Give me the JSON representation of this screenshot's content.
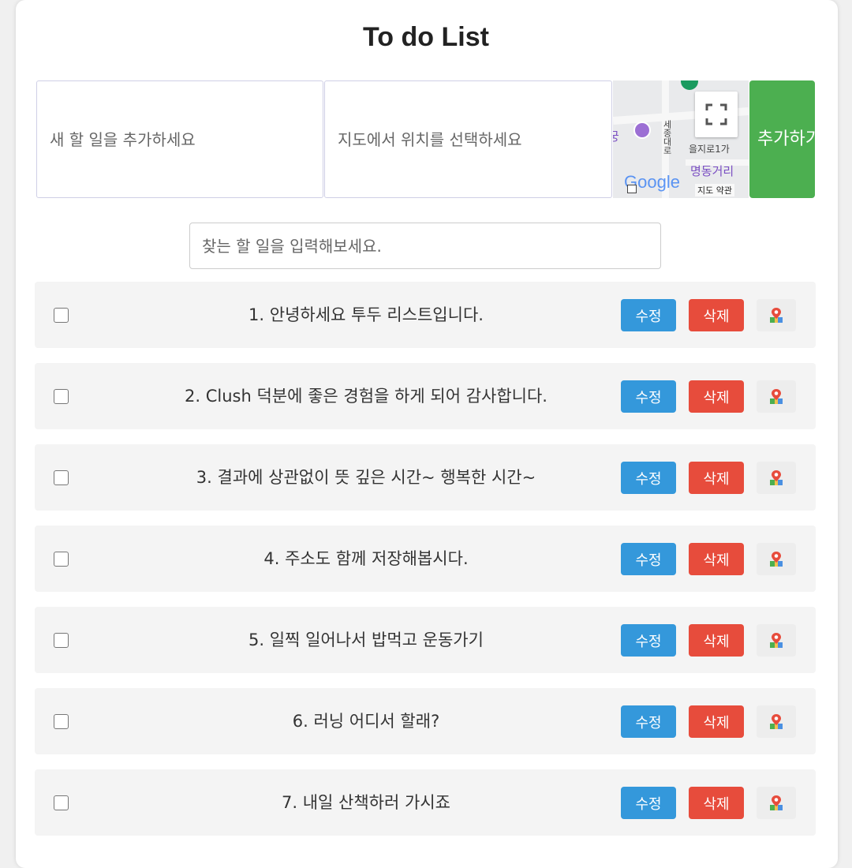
{
  "title": "To do List",
  "add_form": {
    "todo_placeholder": "새 할 일을 추가하세요",
    "location_placeholder": "지도에서 위치를 선택하세요",
    "add_button_label": "추가하기"
  },
  "map": {
    "labels": [
      "세종대로",
      "을지로1가",
      "명동거리",
      "지도 약관"
    ],
    "logo": "Google"
  },
  "search": {
    "placeholder": "찾는 할 일을 입력해보세요."
  },
  "todos": [
    {
      "text": "1. 안녕하세요 투두 리스트입니다.",
      "checked": false
    },
    {
      "text": "2. Clush 덕분에 좋은 경험을 하게 되어 감사합니다.",
      "checked": false
    },
    {
      "text": "3. 결과에 상관없이 뜻 깊은 시간~ 행복한 시간~",
      "checked": false
    },
    {
      "text": "4. 주소도 함께 저장해봅시다.",
      "checked": false
    },
    {
      "text": "5. 일찍 일어나서 밥먹고 운동가기",
      "checked": false
    },
    {
      "text": "6. 러닝 어디서 할래?",
      "checked": false
    },
    {
      "text": "7. 내일 산책하러 가시죠",
      "checked": false
    }
  ],
  "item_buttons": {
    "edit_label": "수정",
    "delete_label": "삭제",
    "map_icon": "map-pin-icon"
  },
  "colors": {
    "add_button": "#4caf50",
    "edit_button": "#3498db",
    "delete_button": "#e74c3c"
  }
}
